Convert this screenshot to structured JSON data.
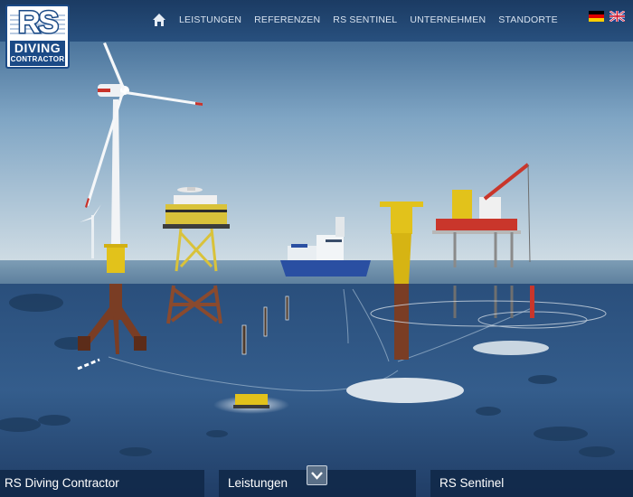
{
  "brand": {
    "logo_main": "RS",
    "logo_line1": "DIVING",
    "logo_line2": "CONTRACTOR"
  },
  "nav": {
    "home_icon": "home-icon",
    "items": [
      {
        "label": "LEISTUNGEN"
      },
      {
        "label": "REFERENZEN"
      },
      {
        "label": "RS SENTINEL"
      },
      {
        "label": "UNTERNEHMEN"
      },
      {
        "label": "STANDORTE"
      }
    ]
  },
  "languages": [
    {
      "code": "de",
      "icon": "german-flag-icon"
    },
    {
      "code": "en",
      "icon": "uk-flag-icon"
    }
  ],
  "bottom_tabs": [
    {
      "label": "RS Diving Contractor"
    },
    {
      "label": "Leistungen"
    },
    {
      "label": "RS Sentinel"
    }
  ],
  "toggle_icon": "chevron-down-icon",
  "colors": {
    "header": "#1b3b63",
    "brand_blue": "#1b4a86",
    "nav_text": "#d8e3f0",
    "turbine_yellow": "#e2c21b"
  }
}
